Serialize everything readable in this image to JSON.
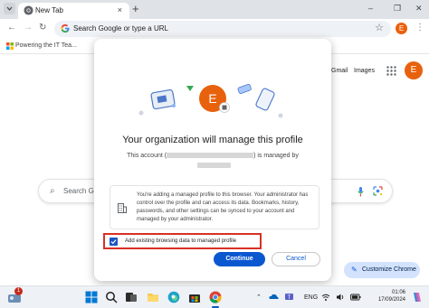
{
  "browser": {
    "tab_title": "New Tab",
    "tab_close": "×",
    "new_tab": "+",
    "window_controls": [
      "–",
      "❐",
      "✕"
    ],
    "omnibox_placeholder": "Search Google or type a URL",
    "profile_initial": "E",
    "bookmark_label": "Powering the IT Tea..."
  },
  "ntp": {
    "links": [
      "Gmail",
      "Images"
    ],
    "search_placeholder": "Search G",
    "customize_label": "Customize Chrome",
    "profile_initial": "E"
  },
  "dialog": {
    "avatar_initial": "E",
    "title": "Your organization will manage this profile",
    "subtitle_prefix": "This account (",
    "subtitle_suffix": ") is managed by",
    "info_text": "You're adding a managed profile to this browser. Your administrator has control over the profile and can access its data. Bookmarks, history, passwords, and other settings can be synced to your account and managed by your administrator.",
    "checkbox_label": "Add existing browsing data to managed profile",
    "checkbox_checked": true,
    "continue_label": "Continue",
    "cancel_label": "Cancel",
    "colors": {
      "accent": "#0b57d0",
      "avatar": "#e8610c",
      "highlight": "#d93025"
    }
  },
  "taskbar": {
    "notification_count": "1",
    "language": "ENG",
    "time": "01:06",
    "date": "17/09/2024"
  }
}
